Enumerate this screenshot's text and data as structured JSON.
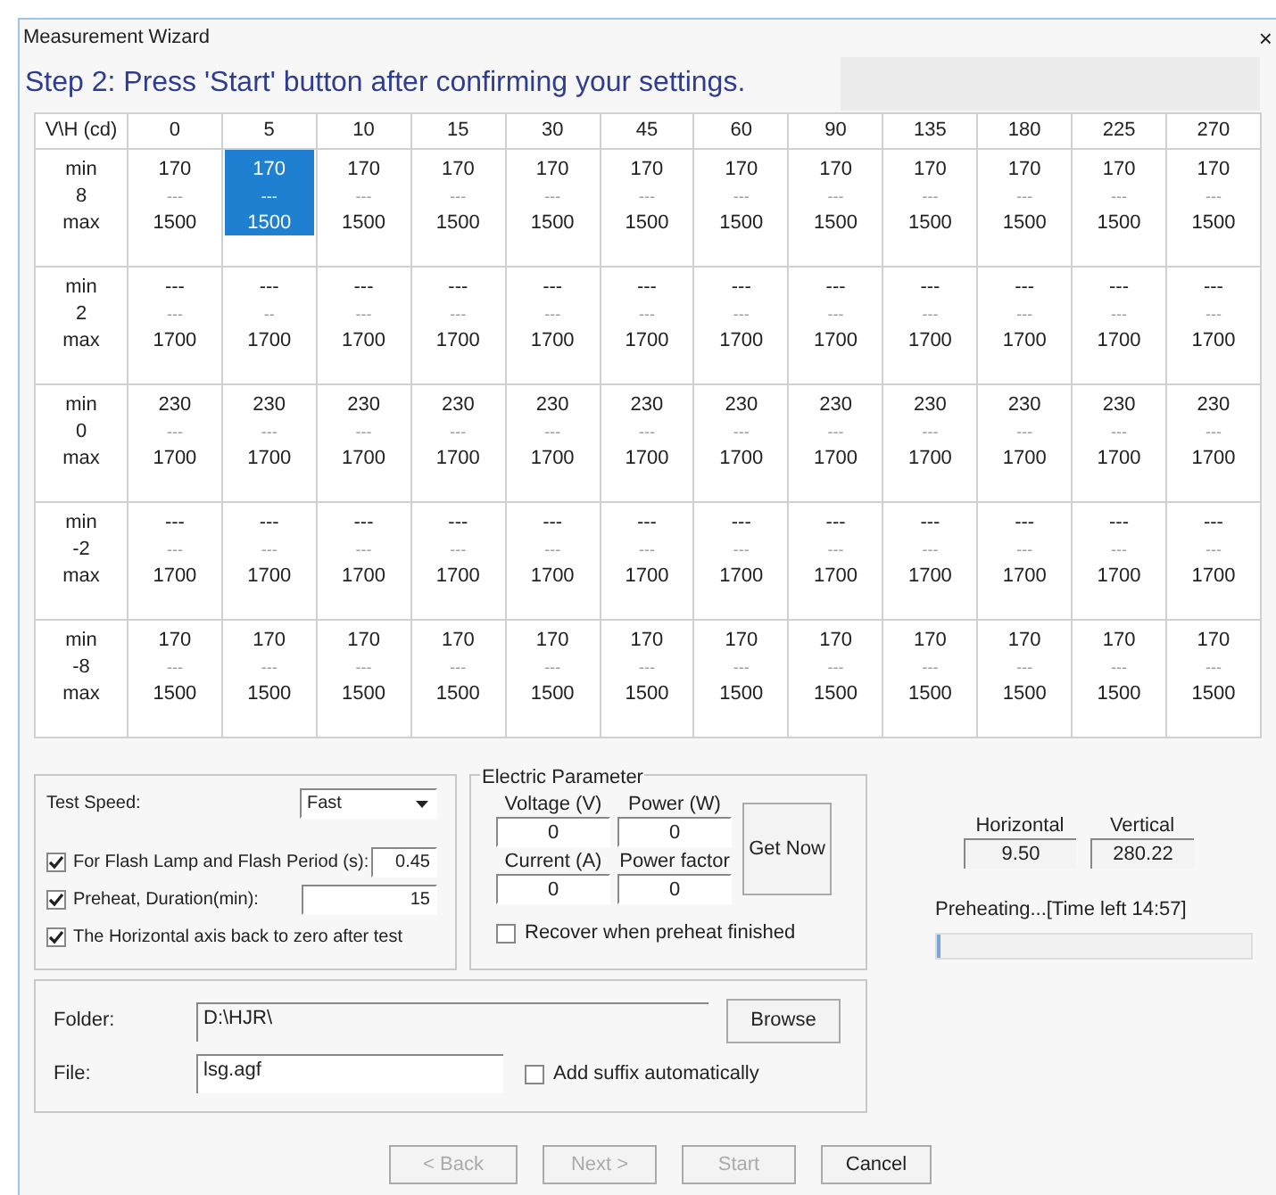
{
  "window": {
    "title": "Measurement Wizard",
    "close": "×"
  },
  "heading": "Step 2: Press 'Start' button after confirming your settings.",
  "table": {
    "corner": "V\\H (cd)",
    "columns": [
      "0",
      "5",
      "10",
      "15",
      "30",
      "45",
      "60",
      "90",
      "135",
      "180",
      "225",
      "270"
    ],
    "rows": [
      {
        "labels": [
          "min",
          "8",
          "max"
        ],
        "cells": [
          {
            "lines": [
              "170",
              "---",
              "1500"
            ],
            "selected": false
          },
          {
            "lines": [
              "170",
              "---",
              "1500"
            ],
            "selected": true
          },
          {
            "lines": [
              "170",
              "---",
              "1500"
            ],
            "selected": false
          },
          {
            "lines": [
              "170",
              "---",
              "1500"
            ],
            "selected": false
          },
          {
            "lines": [
              "170",
              "---",
              "1500"
            ],
            "selected": false
          },
          {
            "lines": [
              "170",
              "---",
              "1500"
            ],
            "selected": false
          },
          {
            "lines": [
              "170",
              "---",
              "1500"
            ],
            "selected": false
          },
          {
            "lines": [
              "170",
              "---",
              "1500"
            ],
            "selected": false
          },
          {
            "lines": [
              "170",
              "---",
              "1500"
            ],
            "selected": false
          },
          {
            "lines": [
              "170",
              "---",
              "1500"
            ],
            "selected": false
          },
          {
            "lines": [
              "170",
              "---",
              "1500"
            ],
            "selected": false
          },
          {
            "lines": [
              "170",
              "---",
              "1500"
            ],
            "selected": false
          }
        ]
      },
      {
        "labels": [
          "min",
          "2",
          "max"
        ],
        "cells": [
          {
            "lines": [
              "---",
              "---",
              "1700"
            ],
            "selected": false
          },
          {
            "lines": [
              "---",
              "--",
              "1700"
            ],
            "selected": false
          },
          {
            "lines": [
              "---",
              "---",
              "1700"
            ],
            "selected": false
          },
          {
            "lines": [
              "---",
              "---",
              "1700"
            ],
            "selected": false
          },
          {
            "lines": [
              "---",
              "---",
              "1700"
            ],
            "selected": false
          },
          {
            "lines": [
              "---",
              "---",
              "1700"
            ],
            "selected": false
          },
          {
            "lines": [
              "---",
              "---",
              "1700"
            ],
            "selected": false
          },
          {
            "lines": [
              "---",
              "---",
              "1700"
            ],
            "selected": false
          },
          {
            "lines": [
              "---",
              "---",
              "1700"
            ],
            "selected": false
          },
          {
            "lines": [
              "---",
              "---",
              "1700"
            ],
            "selected": false
          },
          {
            "lines": [
              "---",
              "---",
              "1700"
            ],
            "selected": false
          },
          {
            "lines": [
              "---",
              "---",
              "1700"
            ],
            "selected": false
          }
        ]
      },
      {
        "labels": [
          "min",
          "0",
          "max"
        ],
        "cells": [
          {
            "lines": [
              "230",
              "---",
              "1700"
            ],
            "selected": false
          },
          {
            "lines": [
              "230",
              "---",
              "1700"
            ],
            "selected": false
          },
          {
            "lines": [
              "230",
              "---",
              "1700"
            ],
            "selected": false
          },
          {
            "lines": [
              "230",
              "---",
              "1700"
            ],
            "selected": false
          },
          {
            "lines": [
              "230",
              "---",
              "1700"
            ],
            "selected": false
          },
          {
            "lines": [
              "230",
              "---",
              "1700"
            ],
            "selected": false
          },
          {
            "lines": [
              "230",
              "---",
              "1700"
            ],
            "selected": false
          },
          {
            "lines": [
              "230",
              "---",
              "1700"
            ],
            "selected": false
          },
          {
            "lines": [
              "230",
              "---",
              "1700"
            ],
            "selected": false
          },
          {
            "lines": [
              "230",
              "---",
              "1700"
            ],
            "selected": false
          },
          {
            "lines": [
              "230",
              "---",
              "1700"
            ],
            "selected": false
          },
          {
            "lines": [
              "230",
              "---",
              "1700"
            ],
            "selected": false
          }
        ]
      },
      {
        "labels": [
          "min",
          "-2",
          "max"
        ],
        "cells": [
          {
            "lines": [
              "---",
              "---",
              "1700"
            ],
            "selected": false
          },
          {
            "lines": [
              "---",
              "---",
              "1700"
            ],
            "selected": false
          },
          {
            "lines": [
              "---",
              "---",
              "1700"
            ],
            "selected": false
          },
          {
            "lines": [
              "---",
              "---",
              "1700"
            ],
            "selected": false
          },
          {
            "lines": [
              "---",
              "---",
              "1700"
            ],
            "selected": false
          },
          {
            "lines": [
              "---",
              "---",
              "1700"
            ],
            "selected": false
          },
          {
            "lines": [
              "---",
              "---",
              "1700"
            ],
            "selected": false
          },
          {
            "lines": [
              "---",
              "---",
              "1700"
            ],
            "selected": false
          },
          {
            "lines": [
              "---",
              "---",
              "1700"
            ],
            "selected": false
          },
          {
            "lines": [
              "---",
              "---",
              "1700"
            ],
            "selected": false
          },
          {
            "lines": [
              "---",
              "---",
              "1700"
            ],
            "selected": false
          },
          {
            "lines": [
              "---",
              "---",
              "1700"
            ],
            "selected": false
          }
        ]
      },
      {
        "labels": [
          "min",
          "-8",
          "max"
        ],
        "cells": [
          {
            "lines": [
              "170",
              "---",
              "1500"
            ],
            "selected": false
          },
          {
            "lines": [
              "170",
              "---",
              "1500"
            ],
            "selected": false
          },
          {
            "lines": [
              "170",
              "---",
              "1500"
            ],
            "selected": false
          },
          {
            "lines": [
              "170",
              "---",
              "1500"
            ],
            "selected": false
          },
          {
            "lines": [
              "170",
              "---",
              "1500"
            ],
            "selected": false
          },
          {
            "lines": [
              "170",
              "---",
              "1500"
            ],
            "selected": false
          },
          {
            "lines": [
              "170",
              "---",
              "1500"
            ],
            "selected": false
          },
          {
            "lines": [
              "170",
              "---",
              "1500"
            ],
            "selected": false
          },
          {
            "lines": [
              "170",
              "---",
              "1500"
            ],
            "selected": false
          },
          {
            "lines": [
              "170",
              "---",
              "1500"
            ],
            "selected": false
          },
          {
            "lines": [
              "170",
              "---",
              "1500"
            ],
            "selected": false
          },
          {
            "lines": [
              "170",
              "---",
              "1500"
            ],
            "selected": false
          }
        ]
      }
    ]
  },
  "settings": {
    "test_speed": {
      "label": "Test Speed:",
      "value": "Fast"
    },
    "options": [
      {
        "label": "For Flash Lamp and Flash Period (s):",
        "checked": true,
        "value": "0.45"
      },
      {
        "label": "Preheat, Duration(min):",
        "checked": true,
        "value": "15"
      },
      {
        "label": "The Horizontal axis back to zero after test",
        "checked": true
      }
    ]
  },
  "electric": {
    "title": "Electric Parameter",
    "fields": [
      {
        "label": "Voltage (V)",
        "value": "0"
      },
      {
        "label": "Power (W)",
        "value": "0"
      },
      {
        "label": "Current (A)",
        "value": "0"
      },
      {
        "label": "Power factor",
        "value": "0"
      }
    ],
    "button": "Get Now",
    "recover": {
      "label": "Recover when preheat finished",
      "checked": false
    }
  },
  "position": {
    "horizontal_label": "Horizontal",
    "horizontal_value": "9.50",
    "vertical_label": "Vertical",
    "vertical_value": "280.22"
  },
  "progress": {
    "text": "Preheating...[Time left 14:57]",
    "level": 0.01
  },
  "files": {
    "folder_label": "Folder:",
    "folder_value": "D:\\HJR\\",
    "browse": "Browse",
    "file_label": "File:",
    "file_value": "lsg.agf",
    "suffix": {
      "label": "Add suffix automatically",
      "checked": false
    }
  },
  "buttons": [
    {
      "label": "< Back",
      "disabled": true
    },
    {
      "label": "Next >",
      "disabled": true
    },
    {
      "label": "Start",
      "disabled": true
    },
    {
      "label": "Cancel",
      "disabled": false
    }
  ]
}
